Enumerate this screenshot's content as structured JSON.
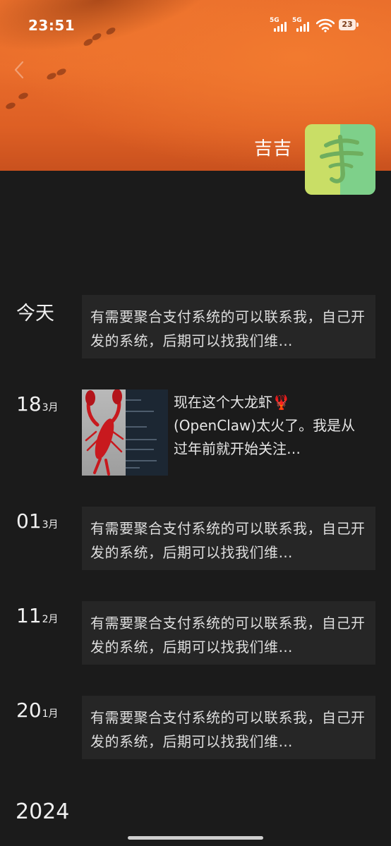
{
  "status_bar": {
    "time": "23:51",
    "sim1": "5G",
    "sim2": "5G",
    "battery": "23"
  },
  "profile": {
    "name": "吉吉"
  },
  "timeline": [
    {
      "date_label": "今天",
      "text": "有需要聚合支付系统的可以联系我，自己开发的系统，后期可以找我们维…"
    },
    {
      "day": "18",
      "month": "3月",
      "has_image": true,
      "text": "现在这个大龙虾🦞(OpenClaw)太火了。我是从过年前就开始关注…"
    },
    {
      "day": "01",
      "month": "3月",
      "text": "有需要聚合支付系统的可以联系我，自己开发的系统，后期可以找我们维…"
    },
    {
      "day": "11",
      "month": "2月",
      "text": "有需要聚合支付系统的可以联系我，自己开发的系统，后期可以找我们维…"
    },
    {
      "day": "20",
      "month": "1月",
      "text": "有需要聚合支付系统的可以联系我，自己开发的系统，后期可以找我们维…"
    }
  ],
  "year_label": "2024",
  "colors": {
    "background": "#1b1b1b",
    "card": "#262626",
    "cover_orange": "#e96c2b",
    "avatar_yellow": "#c9de66",
    "avatar_green": "#7ed08a"
  }
}
